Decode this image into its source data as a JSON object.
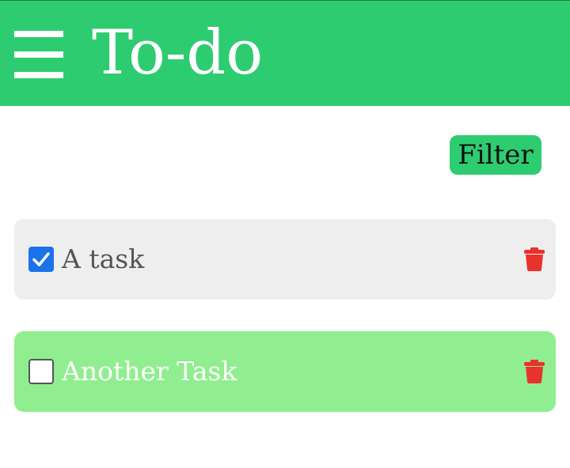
{
  "header": {
    "title": "To-do",
    "background": "#2ecc71",
    "menu_icon": "hamburger-menu-icon"
  },
  "toolbar": {
    "filter_label": "Filter"
  },
  "tasks": [
    {
      "label": "A task",
      "checked": true,
      "background": "#eeeeee",
      "text_color": "#555555"
    },
    {
      "label": "Another Task",
      "checked": false,
      "background": "#90ee90",
      "text_color": "#ffffff"
    }
  ],
  "colors": {
    "delete_icon": "#e8322c",
    "checkbox_checked": "#1a73e8"
  }
}
